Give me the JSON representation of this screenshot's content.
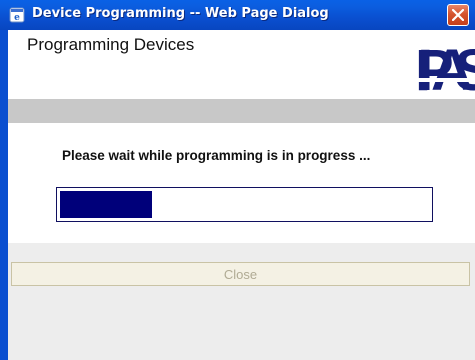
{
  "window": {
    "title": "Device Programming -- Web Page Dialog",
    "icon": "ie-icon",
    "close_icon": "close-icon"
  },
  "header": {
    "title": "Programming Devices",
    "logo_text": "IPAS"
  },
  "content": {
    "message": "Please wait while programming is in progress ...",
    "progress": {
      "value": 0.25
    }
  },
  "footer": {
    "close_label": "Close",
    "close_enabled": false
  },
  "colors": {
    "titlebar": "#0a55d8",
    "progress_fill": "#00007a"
  }
}
